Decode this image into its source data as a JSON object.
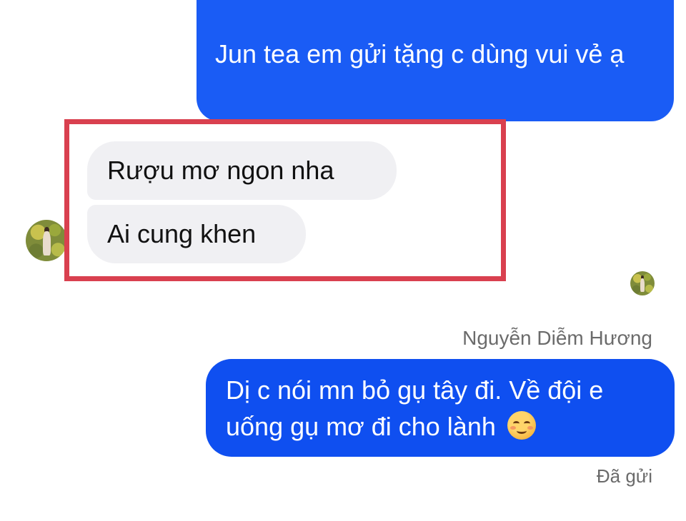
{
  "messages": {
    "outgoing_top": {
      "text": "Jun tea em gửi tặng c dùng vui vẻ ạ"
    },
    "incoming": [
      {
        "text": "Rượu mơ ngon nha"
      },
      {
        "text": "Ai cung khen"
      }
    ],
    "outgoing_reply": {
      "sender_name": "Nguyễn Diễm Hương",
      "text": "Dị c nói mn bỏ gụ tây đi. Về đội e uống gụ mơ đi cho lành",
      "emoji": "smiling-face-icon",
      "status": "Đã gửi"
    }
  },
  "colors": {
    "outgoing_bubble": "#1a5cf5",
    "incoming_bubble": "#f0f0f3",
    "highlight_border": "#d9404f",
    "meta_text": "#6b6b6b"
  }
}
